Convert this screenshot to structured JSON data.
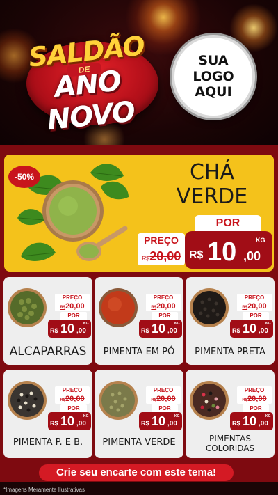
{
  "header": {
    "title_top": "SALDÃO",
    "title_mid": "DE",
    "title_bottom": "ANO NOVO",
    "logo_text": "SUA\nLOGO\nAQUI"
  },
  "featured": {
    "discount": "-50%",
    "name": "CHÁ\nVERDE",
    "por_label": "POR",
    "preco_label": "PREÇO",
    "old_currency": "R$",
    "old_price": "20,00",
    "currency": "R$",
    "price_int": "10",
    "price_dec": ",00",
    "unit": "KG"
  },
  "products": [
    {
      "name": "ALCAPARRAS",
      "preco_label": "PREÇO",
      "old_currency": "R$",
      "old_price": "20,00",
      "por_label": "POR",
      "currency": "R$",
      "price_int": "10",
      "price_dec": ",00",
      "unit": "KG",
      "icon": "capers-bowl-icon"
    },
    {
      "name": "PIMENTA EM PÓ",
      "preco_label": "PREÇO",
      "old_currency": "R$",
      "old_price": "20,00",
      "por_label": "POR",
      "currency": "R$",
      "price_int": "10",
      "price_dec": ",00",
      "unit": "KG",
      "icon": "paprika-bowl-icon"
    },
    {
      "name": "PIMENTA PRETA",
      "preco_label": "PREÇO",
      "old_currency": "R$",
      "old_price": "20,00",
      "por_label": "POR",
      "currency": "R$",
      "price_int": "10",
      "price_dec": ",00",
      "unit": "KG",
      "icon": "black-pepper-bowl-icon"
    },
    {
      "name": "PIMENTA P. E B.",
      "preco_label": "PREÇO",
      "old_currency": "R$",
      "old_price": "20,00",
      "por_label": "POR",
      "currency": "R$",
      "price_int": "10",
      "price_dec": ",00",
      "unit": "KG",
      "icon": "mixed-pepper-bowl-icon"
    },
    {
      "name": "PIMENTA VERDE",
      "preco_label": "PREÇO",
      "old_currency": "R$",
      "old_price": "20,00",
      "por_label": "POR",
      "currency": "R$",
      "price_int": "10",
      "price_dec": ",00",
      "unit": "KG",
      "icon": "green-pepper-bowl-icon"
    },
    {
      "name": "PIMENTAS\nCOLORIDAS",
      "preco_label": "PREÇO",
      "old_currency": "R$",
      "old_price": "20,00",
      "por_label": "POR",
      "currency": "R$",
      "price_int": "10",
      "price_dec": ",00",
      "unit": "KG",
      "icon": "colored-pepper-bowl-icon"
    }
  ],
  "cta": {
    "label": "Crie seu encarte com este tema!"
  },
  "disclaimer": "*Imagens Meramente Ilustrativas",
  "colors": {
    "brand_red": "#a10d16",
    "accent_yellow": "#f4c21b",
    "background_dark": "#1a0506",
    "card_bg": "#eeeeee"
  }
}
